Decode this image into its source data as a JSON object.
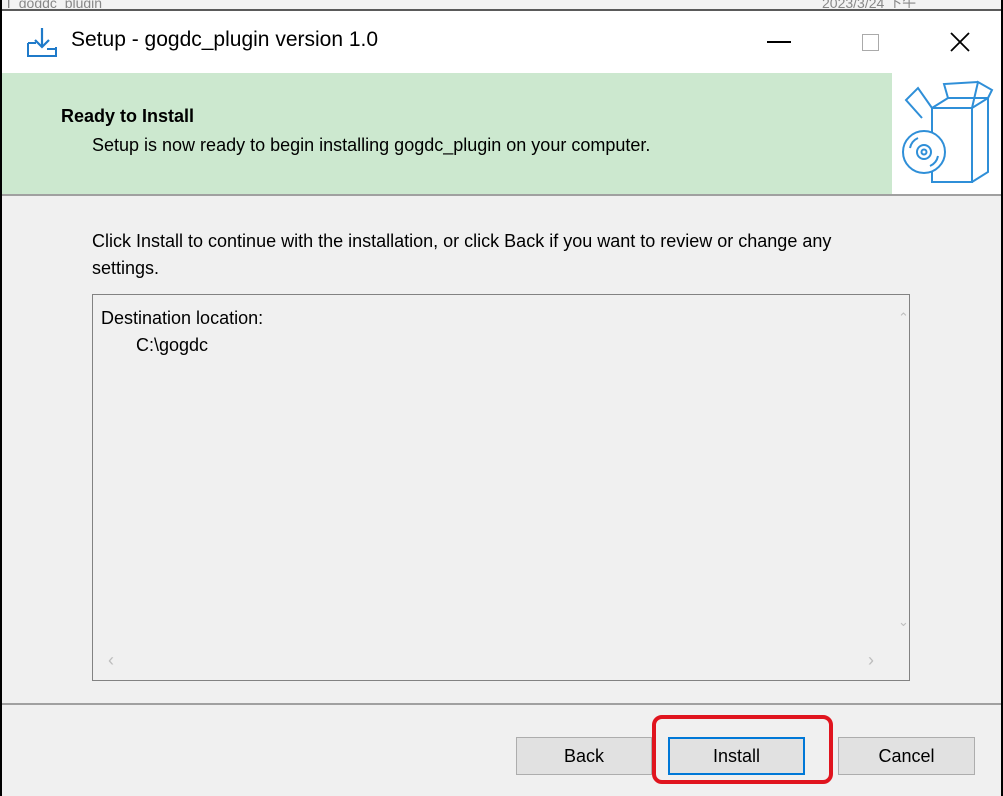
{
  "window": {
    "title": "Setup - gogdc_plugin version 1.0",
    "controls": {
      "minimize": "minimize-icon",
      "maximize": "maximize-icon",
      "close_glyph": "✕"
    }
  },
  "header": {
    "title": "Ready to Install",
    "subtitle": "Setup is now ready to begin installing gogdc_plugin on your computer."
  },
  "body": {
    "instructions": "Click Install to continue with the installation, or click Back if you want to review or change any settings.",
    "memo": {
      "label": "Destination location:",
      "value": "C:\\gogdc"
    },
    "scrollbar_arrows": {
      "up": "⌃",
      "down": "⌄",
      "left": "‹",
      "right": "›"
    }
  },
  "buttons": {
    "back": "Back",
    "install": "Install",
    "cancel": "Cancel"
  },
  "icons": {
    "app": "download-install-icon",
    "wizard": "software-box-disc-icon"
  },
  "colors": {
    "header_bg": "#cce8cf",
    "highlight": "#e0141e",
    "default_button_border": "#0078d7"
  }
}
